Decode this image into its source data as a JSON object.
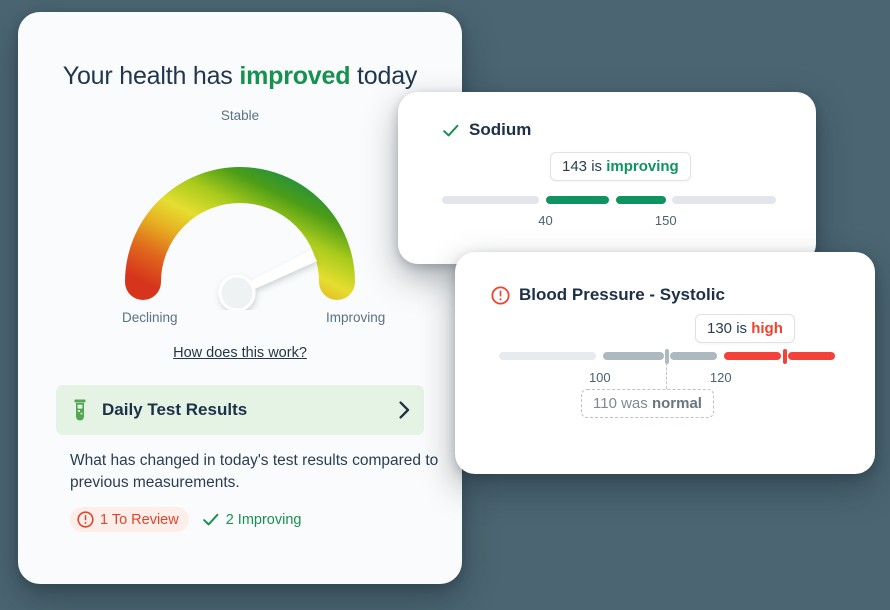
{
  "background_color": "#4b6572",
  "main_card": {
    "headline_prefix": "Your health has ",
    "headline_accent": "improved",
    "headline_suffix": " today",
    "gauge": {
      "top_label": "Stable",
      "left_label": "Declining",
      "right_label": "Improving",
      "needle_angle_deg": 50,
      "gradient_stops": [
        "#d6341c",
        "#e8a722",
        "#e5de30",
        "#8dc21d",
        "#4e9e16",
        "#0f8b52"
      ]
    },
    "how_link": "How does this work?",
    "daily_test_results": {
      "icon": "test-tube-icon",
      "title": "Daily Test Results",
      "chevron": "chevron-right-icon",
      "banner_color": "#e5f3e4",
      "description": "What has changed in today's test results compared to previous measurements.",
      "badges": [
        {
          "icon": "alert-circle-icon",
          "label": "1 To Review",
          "color": "#e0452c"
        },
        {
          "icon": "check-icon",
          "label": "2 Improving",
          "color": "#18924f"
        }
      ]
    }
  },
  "sodium_card": {
    "status_icon": "check-icon",
    "title": "Sodium",
    "tooltip": {
      "value": "143",
      "connector": " is ",
      "status": "improving",
      "status_color": "#0f9360"
    },
    "range": {
      "ticks": [
        {
          "label": "40",
          "pos_pct": 31
        },
        {
          "label": "150",
          "pos_pct": 67
        }
      ],
      "segments": [
        {
          "start_pct": 0,
          "end_pct": 29,
          "color": "#e2e6e9"
        },
        {
          "start_pct": 31,
          "end_pct": 50,
          "color": "#0f9360"
        },
        {
          "start_pct": 52,
          "end_pct": 67,
          "color": "#0f9360"
        },
        {
          "start_pct": 69,
          "end_pct": 100,
          "color": "#e2e6e9"
        }
      ],
      "markers": [
        {
          "pos_pct": 50.5,
          "color": "#ffffff"
        }
      ]
    }
  },
  "bp_card": {
    "status_icon": "alert-circle-icon",
    "title": "Blood Pressure - Systolic",
    "tooltip": {
      "value": "130",
      "connector": " is ",
      "status": "high",
      "status_color": "#f4402e"
    },
    "previous_tooltip": {
      "value": "110",
      "connector": " was ",
      "status": "normal"
    },
    "range": {
      "ticks": [
        {
          "label": "100",
          "pos_pct": 30
        },
        {
          "label": "120",
          "pos_pct": 66
        }
      ],
      "segments": [
        {
          "start_pct": 0,
          "end_pct": 29,
          "color": "#e7ebed"
        },
        {
          "start_pct": 31,
          "end_pct": 49,
          "color": "#aeb8bf"
        },
        {
          "start_pct": 51,
          "end_pct": 65,
          "color": "#aeb8bf"
        },
        {
          "start_pct": 67,
          "end_pct": 84,
          "color": "#f4413a"
        },
        {
          "start_pct": 86,
          "end_pct": 100,
          "color": "#f4413a"
        }
      ],
      "markers": [
        {
          "pos_pct": 50,
          "color": "#aeb8bf"
        },
        {
          "pos_pct": 85,
          "color": "#f4413a"
        }
      ]
    }
  }
}
